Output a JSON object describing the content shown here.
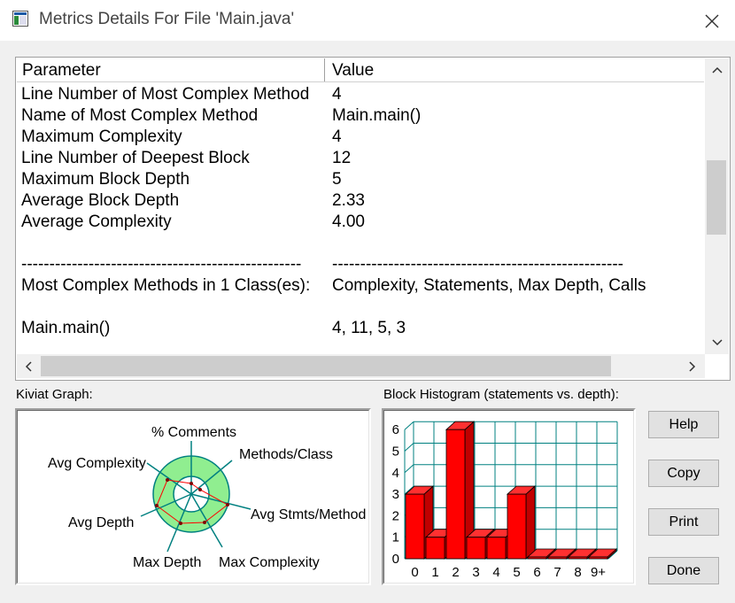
{
  "window": {
    "title": "Metrics Details For File 'Main.java'"
  },
  "table": {
    "header": {
      "parameter": "Parameter",
      "value": "Value"
    },
    "rows": [
      {
        "param": "Line Number of Most Complex Method",
        "value": "4"
      },
      {
        "param": "Name of Most Complex Method",
        "value": "Main.main()"
      },
      {
        "param": "Maximum Complexity",
        "value": "4"
      },
      {
        "param": "Line Number of Deepest Block",
        "value": "12"
      },
      {
        "param": "Maximum Block Depth",
        "value": "5"
      },
      {
        "param": "Average Block Depth",
        "value": "2.33"
      },
      {
        "param": "Average Complexity",
        "value": "4.00"
      },
      {
        "param": "",
        "value": ""
      },
      {
        "param": "--------------------------------------------------",
        "value": "----------------------------------------------------"
      },
      {
        "param": "Most Complex Methods in 1 Class(es):",
        "value": "Complexity, Statements, Max Depth, Calls"
      },
      {
        "param": "",
        "value": ""
      },
      {
        "param": "Main.main()",
        "value": "4, 11, 5, 3"
      }
    ]
  },
  "kiviat": {
    "label": "Kiviat Graph:",
    "axes": [
      "% Comments",
      "Methods/Class",
      "Avg Stmts/Method",
      "Max Complexity",
      "Max Depth",
      "Avg Depth",
      "Avg Complexity"
    ]
  },
  "histogram": {
    "label": "Block Histogram (statements vs. depth):",
    "chart_data": {
      "type": "bar",
      "categories": [
        "0",
        "1",
        "2",
        "3",
        "4",
        "5",
        "6",
        "7",
        "8",
        "9+"
      ],
      "values": [
        3,
        1,
        6,
        1,
        1,
        3,
        0,
        0,
        0,
        0
      ],
      "ylim": [
        0,
        6
      ],
      "yticks": [
        "0",
        "1",
        "2",
        "3",
        "4",
        "5",
        "6"
      ],
      "bar_color": "#ff0000",
      "grid_color": "#008080"
    }
  },
  "buttons": {
    "help": "Help",
    "copy": "Copy",
    "print": "Print",
    "done": "Done"
  }
}
